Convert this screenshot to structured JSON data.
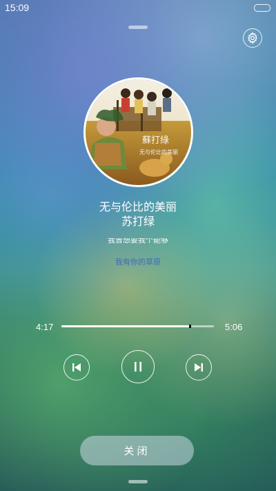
{
  "status_bar": {
    "time": "15:09"
  },
  "player": {
    "song_title": "无与伦比的美丽",
    "artist": "苏打绿",
    "lyric_previous": "我曾想要我个能够",
    "lyric_next": "我有你的草原",
    "elapsed": "4:17",
    "duration": "5:06",
    "progress": 0.84
  },
  "album_art": {
    "cover_text_line1": "蘇打綠",
    "cover_text_line2": "无与伦比的美丽"
  },
  "icons": {
    "settings": "gear-icon",
    "previous": "skip-previous-icon",
    "pause": "pause-icon",
    "next": "skip-next-icon"
  },
  "actions": {
    "close_label": "关闭"
  },
  "colors": {
    "lyric_next": "#3f68c7",
    "close_button_bg": "rgba(200,215,225,0.55)"
  }
}
